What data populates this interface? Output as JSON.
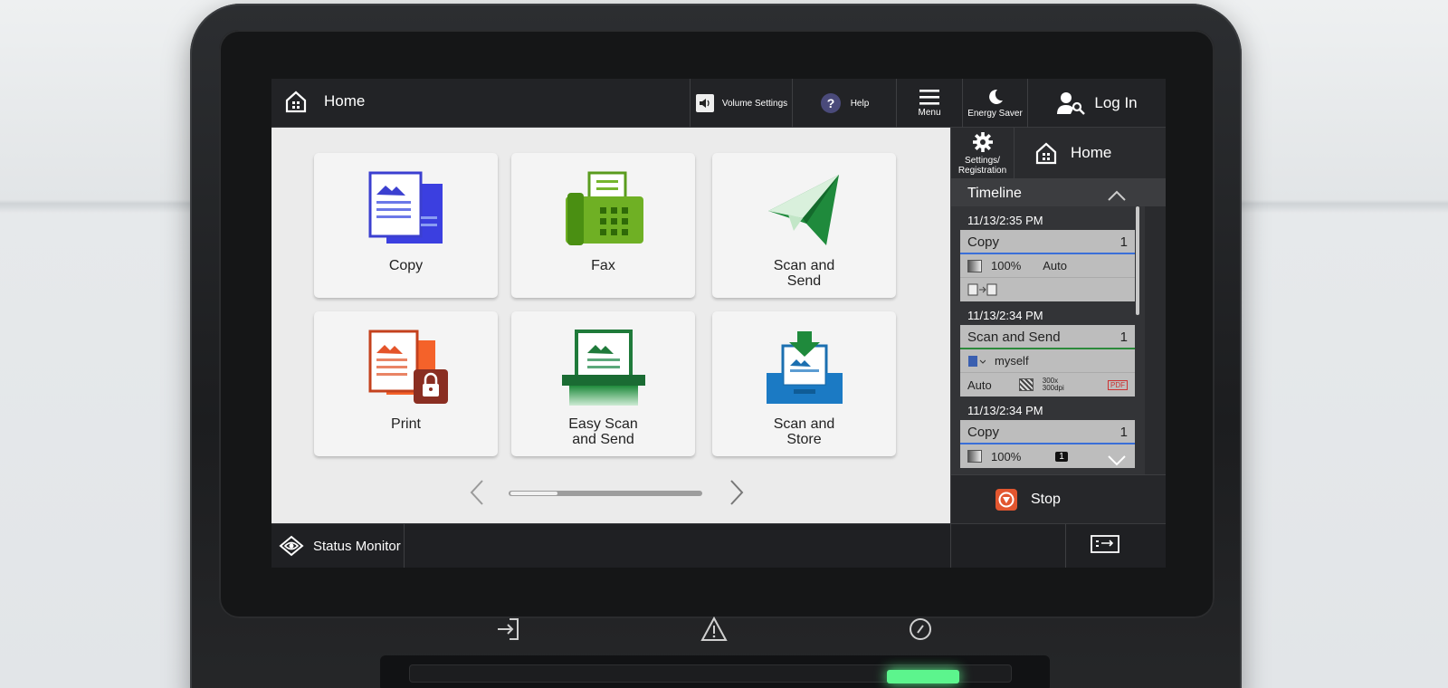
{
  "topbar": {
    "home_label": "Home",
    "volume_label": "Volume Settings",
    "help_label": "Help",
    "menu_label": "Menu",
    "energy_label": "Energy Saver",
    "login_label": "Log In"
  },
  "functions": [
    {
      "label": "Copy",
      "icon": "copy-icon"
    },
    {
      "label": "Fax",
      "icon": "fax-icon"
    },
    {
      "label": "Scan and\nSend",
      "icon": "scan-send-icon"
    },
    {
      "label": "Print",
      "icon": "secure-print-icon"
    },
    {
      "label": "Easy Scan\nand Send",
      "icon": "easy-scan-icon"
    },
    {
      "label": "Scan and\nStore",
      "icon": "scan-store-icon"
    }
  ],
  "pager": {
    "position": 0.2
  },
  "right_panel": {
    "settings_label": "Settings/\nRegistration",
    "home_label": "Home",
    "timeline_title": "Timeline",
    "stop_label": "Stop"
  },
  "timeline": [
    {
      "time": "11/13/2:35 PM",
      "job": "Copy",
      "count": "1",
      "zoom": "100%",
      "mode": "Auto"
    },
    {
      "time": "11/13/2:34 PM",
      "job": "Scan and Send",
      "count": "1",
      "dest": "myself",
      "mode": "Auto",
      "res_a": "300x",
      "res_b": "300dpi",
      "format": "PDF"
    },
    {
      "time": "11/13/2:34 PM",
      "job": "Copy",
      "count": "1",
      "zoom": "100%",
      "copies_badge": "1"
    }
  ],
  "bottombar": {
    "status_label": "Status Monitor"
  },
  "colors": {
    "accent_blue": "#3a6fd8",
    "accent_green": "#2c8a3b",
    "stop_orange": "#e2562f",
    "power_led": "#5cf58d"
  }
}
